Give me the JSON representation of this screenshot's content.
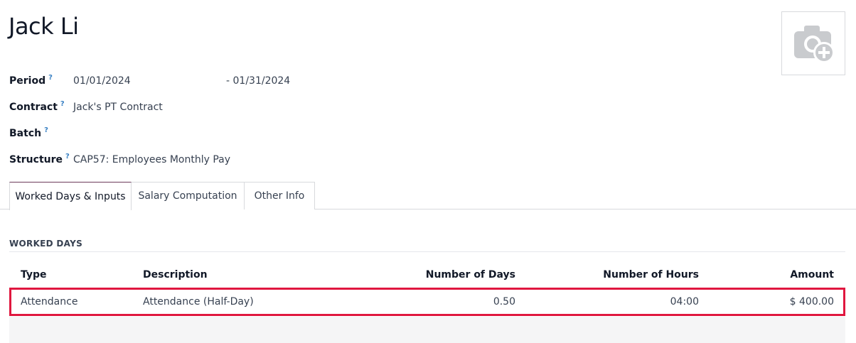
{
  "record": {
    "title": "Jack Li"
  },
  "avatar": {
    "icon": "camera-plus-icon"
  },
  "fields": {
    "period": {
      "label": "Period",
      "help": "?",
      "start": "01/01/2024",
      "end": "- 01/31/2024"
    },
    "contract": {
      "label": "Contract",
      "help": "?",
      "value": "Jack's PT Contract"
    },
    "batch": {
      "label": "Batch",
      "help": "?",
      "value": ""
    },
    "structure": {
      "label": "Structure",
      "help": "?",
      "value": "CAP57: Employees Monthly Pay"
    }
  },
  "tabs": [
    {
      "label": "Worked Days & Inputs",
      "active": true
    },
    {
      "label": "Salary Computation",
      "active": false
    },
    {
      "label": "Other Info",
      "active": false
    }
  ],
  "worked_days": {
    "section_title": "WORKED DAYS",
    "columns": {
      "type": "Type",
      "description": "Description",
      "days": "Number of Days",
      "hours": "Number of Hours",
      "amount": "Amount"
    },
    "rows": [
      {
        "type": "Attendance",
        "description": "Attendance (Half-Day)",
        "days": "0.50",
        "hours": "04:00",
        "amount": "$ 400.00"
      }
    ]
  },
  "colors": {
    "highlight": "#e0173f",
    "active_tab_accent": "#6c3a5a",
    "help": "#3b82c4"
  }
}
